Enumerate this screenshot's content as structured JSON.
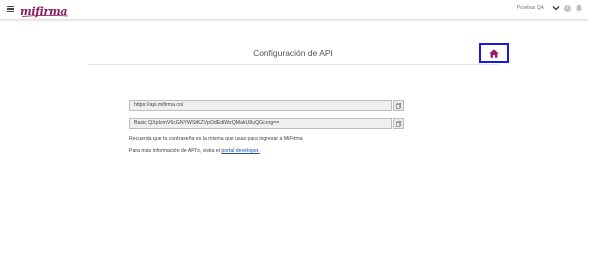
{
  "topbar": {
    "logo_text": "mifirma",
    "user_name": "Pruebas QA",
    "info_icon_char": "i"
  },
  "page": {
    "title": "Configuración de API"
  },
  "fields": [
    {
      "label": "",
      "value": "https://api.mifirma.co/"
    },
    {
      "label": "",
      "value": "Basic QXpIcmV6cGNYWStKZVpOdEdiWzQMakU8uQGcorg=="
    }
  ],
  "notes": {
    "password_note": "Recuerda que tu contraseña es la misma que usas para ingresar a MiFirma",
    "info_prefix": "Para más información de API's, visita el ",
    "portal_link": "portal developer."
  },
  "colors": {
    "brand": "#8a1a5c",
    "home_icon": "#9a1a6a",
    "highlight_border": "#1a1adc",
    "link": "#1f4fa8"
  },
  "icons": {
    "menu": "hamburger-icon",
    "dropdown": "chevron-down-icon",
    "info": "info-icon",
    "notifications": "bell-icon",
    "home": "home-icon",
    "copy": "copy-icon"
  }
}
